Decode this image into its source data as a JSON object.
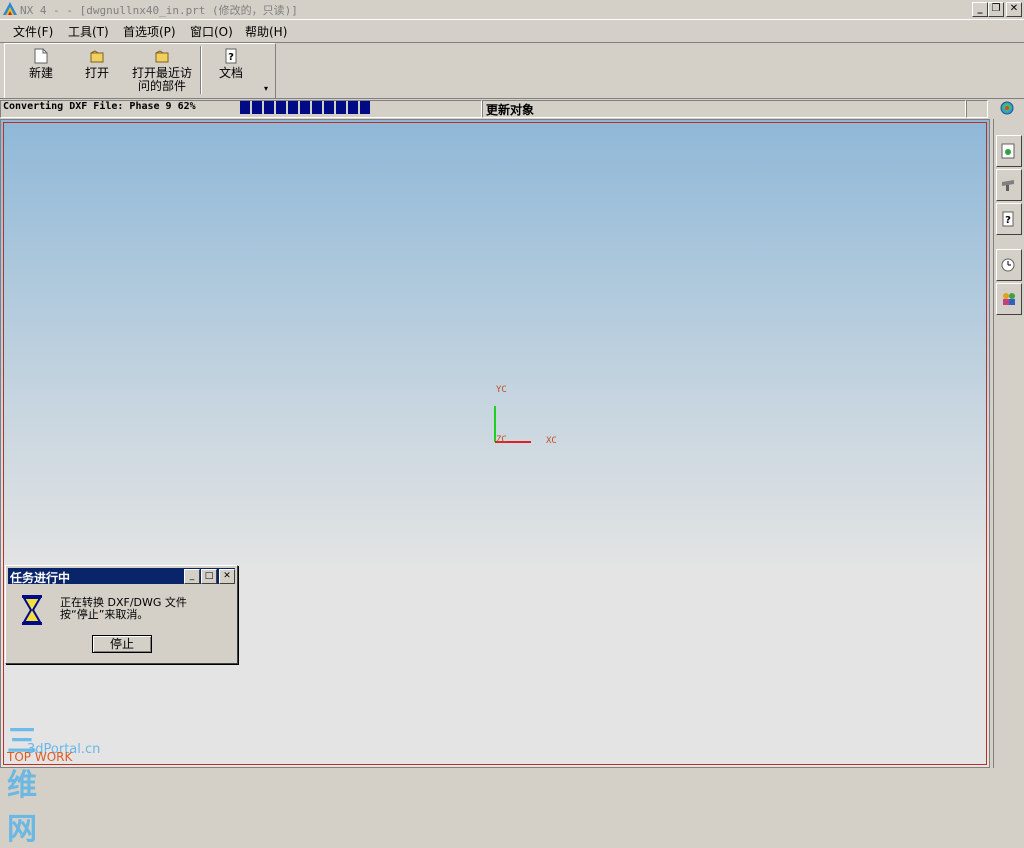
{
  "window": {
    "title": "NX 4 - - [dwgnullnx40_in.prt (修改的，只读)]"
  },
  "menu": {
    "items": [
      "文件(F)",
      "工具(T)",
      "首选项(P)",
      "窗口(O)",
      "帮助(H)"
    ]
  },
  "toolbar": {
    "new_label": "新建",
    "open_label": "打开",
    "recent_label_line1": "打开最近访",
    "recent_label_line2": "问的部件",
    "docs_label": "文档"
  },
  "status": {
    "progress_text": "Converting DXF File: Phase 9 62%",
    "progress_percent": 62,
    "progress_segments": 11,
    "message": "更新对象"
  },
  "viewport": {
    "axis_x": "XC",
    "axis_y": "YC",
    "axis_z": "ZC",
    "colors": {
      "x_axis": "#e02020",
      "y_axis": "#20d020",
      "sky_top": "#8fb8d8",
      "floor": "#e4e4e4"
    }
  },
  "dialog": {
    "title": "任务进行中",
    "line1": "正在转换 DXF/DWG 文件",
    "line2": "按“停止”来取消。",
    "stop_label": "停止"
  },
  "watermark": {
    "big": "三维网",
    "small": "3dPortal.cn",
    "top": "TOP WORK"
  },
  "icons": [
    "app-logo-icon",
    "new-file-icon",
    "open-folder-icon",
    "recent-folder-icon",
    "help-doc-icon",
    "globe-icon",
    "history-icon",
    "roles-icon",
    "clock-icon",
    "people-icon",
    "hourglass-icon"
  ]
}
